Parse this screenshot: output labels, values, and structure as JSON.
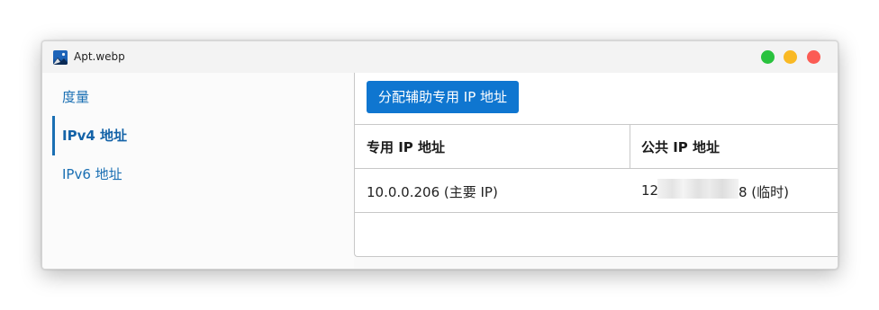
{
  "window": {
    "title": "Apt.webp",
    "icon": "image-file-icon",
    "controls": {
      "green": "#29c23e",
      "yellow": "#f9b924",
      "red": "#fb5c54"
    }
  },
  "sidebar": {
    "items": [
      {
        "label": "度量",
        "active": false
      },
      {
        "label": "IPv4 地址",
        "active": true
      },
      {
        "label": "IPv6 地址",
        "active": false
      }
    ]
  },
  "main": {
    "assign_button_label": "分配辅助专用 IP 地址",
    "table": {
      "headers": [
        "专用 IP 地址",
        "公共 IP 地址"
      ],
      "rows": [
        {
          "private_ip": "10.0.0.206 (主要 IP)",
          "public_ip_prefix": "12",
          "public_ip_suffix": "8 (临时)"
        }
      ]
    }
  },
  "colors": {
    "accent": "#0f76d0",
    "link": "#1a6fb3"
  }
}
